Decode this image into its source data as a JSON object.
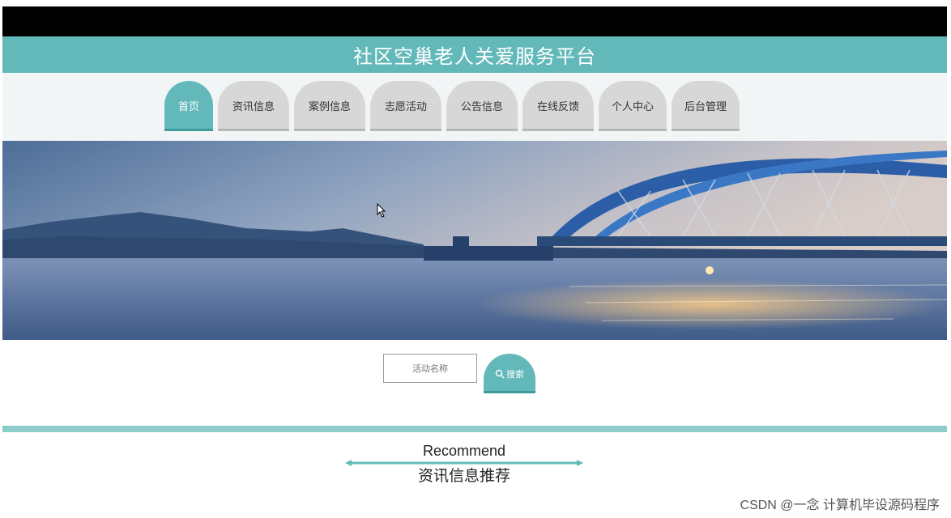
{
  "header": {
    "site_title": "社区空巢老人关爱服务平台"
  },
  "nav": {
    "items": [
      {
        "label": "首页",
        "active": true
      },
      {
        "label": "资讯信息",
        "active": false
      },
      {
        "label": "案例信息",
        "active": false
      },
      {
        "label": "志愿活动",
        "active": false
      },
      {
        "label": "公告信息",
        "active": false
      },
      {
        "label": "在线反馈",
        "active": false
      },
      {
        "label": "个人中心",
        "active": false
      },
      {
        "label": "后台管理",
        "active": false
      }
    ]
  },
  "banner": {
    "image": "bridge-over-lake-sunset"
  },
  "search": {
    "placeholder": "活动名称",
    "button_label": "搜索",
    "button_icon": "search-icon"
  },
  "recommend": {
    "title_en": "Recommend",
    "title_cn": "资讯信息推荐"
  },
  "watermark": "CSDN @一念 计算机毕设源码程序",
  "colors": {
    "primary": "#63b8b9",
    "nav_inactive": "#d7d7d7",
    "divider": "#8ccdc9",
    "top_bar": "#000000"
  }
}
